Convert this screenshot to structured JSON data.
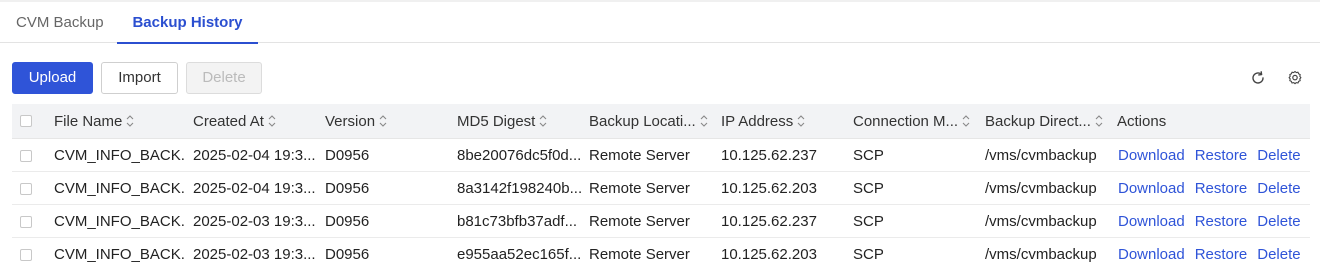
{
  "tabs": [
    {
      "label": "CVM Backup"
    },
    {
      "label": "Backup History"
    }
  ],
  "toolbar": {
    "upload_label": "Upload",
    "import_label": "Import",
    "delete_label": "Delete"
  },
  "table": {
    "headers": {
      "file_name": "File Name",
      "created_at": "Created At",
      "version": "Version",
      "md5": "MD5 Digest",
      "location": "Backup Locati...",
      "ip": "IP Address",
      "connection": "Connection M...",
      "directory": "Backup Direct...",
      "actions": "Actions"
    },
    "rows": [
      {
        "file_name": "CVM_INFO_BACK...",
        "created_at": "2025-02-04 19:3...",
        "version": "D0956",
        "md5": "8be20076dc5f0d...",
        "location": "Remote Server",
        "ip": "10.125.62.237",
        "connection": "SCP",
        "directory": "/vms/cvmbackup"
      },
      {
        "file_name": "CVM_INFO_BACK...",
        "created_at": "2025-02-04 19:3...",
        "version": "D0956",
        "md5": "8a3142f198240b...",
        "location": "Remote Server",
        "ip": "10.125.62.203",
        "connection": "SCP",
        "directory": "/vms/cvmbackup"
      },
      {
        "file_name": "CVM_INFO_BACK...",
        "created_at": "2025-02-03 19:3...",
        "version": "D0956",
        "md5": "b81c73bfb37adf...",
        "location": "Remote Server",
        "ip": "10.125.62.237",
        "connection": "SCP",
        "directory": "/vms/cvmbackup"
      },
      {
        "file_name": "CVM_INFO_BACK...",
        "created_at": "2025-02-03 19:3...",
        "version": "D0956",
        "md5": "e955aa52ec165f...",
        "location": "Remote Server",
        "ip": "10.125.62.203",
        "connection": "SCP",
        "directory": "/vms/cvmbackup"
      }
    ],
    "row_actions": {
      "download": "Download",
      "restore": "Restore",
      "delete": "Delete"
    }
  },
  "icons": {
    "refresh": "refresh-icon",
    "settings": "gear-icon",
    "sort": "sort-icon"
  },
  "colors": {
    "primary": "#2f54d8",
    "active_tab": "#2b4fd0",
    "header_bg": "#f2f3f5"
  }
}
